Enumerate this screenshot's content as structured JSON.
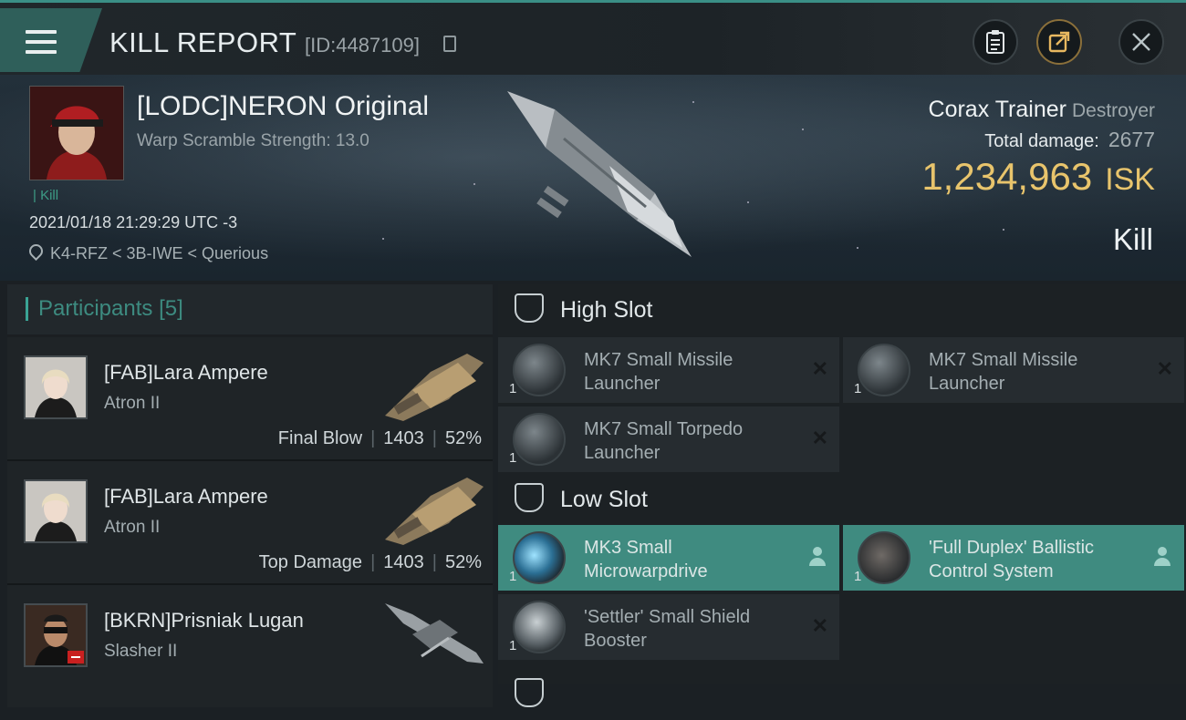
{
  "header": {
    "title": "KILL REPORT",
    "report_id": "[ID:4487109]"
  },
  "victim": {
    "name": "[LODC]NERON Original",
    "warp": "Warp Scramble Strength: 13.0",
    "tag": "| Kill",
    "datetime": "2021/01/18 21:29:29 UTC -3",
    "location": "K4-RFZ < 3B-IWE < Querious",
    "ship_name": "Corax Trainer",
    "ship_class": "Destroyer",
    "total_damage_label": "Total damage:",
    "total_damage": "2677",
    "isk_value": "1,234,963",
    "isk_unit": "ISK",
    "result": "Kill"
  },
  "participants": {
    "label": "Participants",
    "count": "[5]",
    "rows": [
      {
        "name": "[FAB]Lara Ampere",
        "ship": "Atron II",
        "role": "Final Blow",
        "damage": "1403",
        "percent": "52%"
      },
      {
        "name": "[FAB]Lara Ampere",
        "ship": "Atron II",
        "role": "Top Damage",
        "damage": "1403",
        "percent": "52%"
      },
      {
        "name": "[BKRN]Prisniak Lugan",
        "ship": "Slasher II",
        "role": "",
        "damage": "",
        "percent": ""
      }
    ]
  },
  "slots": {
    "high": {
      "label": "High Slot",
      "modules": [
        {
          "name": "MK7 Small Missile Launcher",
          "qty": "1"
        },
        {
          "name": "MK7 Small Missile Launcher",
          "qty": "1"
        },
        {
          "name": "MK7 Small Torpedo Launcher",
          "qty": "1"
        }
      ]
    },
    "low": {
      "label": "Low Slot",
      "modules": [
        {
          "name": "MK3 Small Microwarpdrive",
          "qty": "1"
        },
        {
          "name": "'Full Duplex' Ballistic Control System",
          "qty": "1"
        },
        {
          "name": "'Settler' Small Shield Booster",
          "qty": "1"
        }
      ]
    }
  },
  "colors": {
    "accent": "#3aa495",
    "isk": "#e8c46c",
    "module_active": "#3f8b80"
  }
}
